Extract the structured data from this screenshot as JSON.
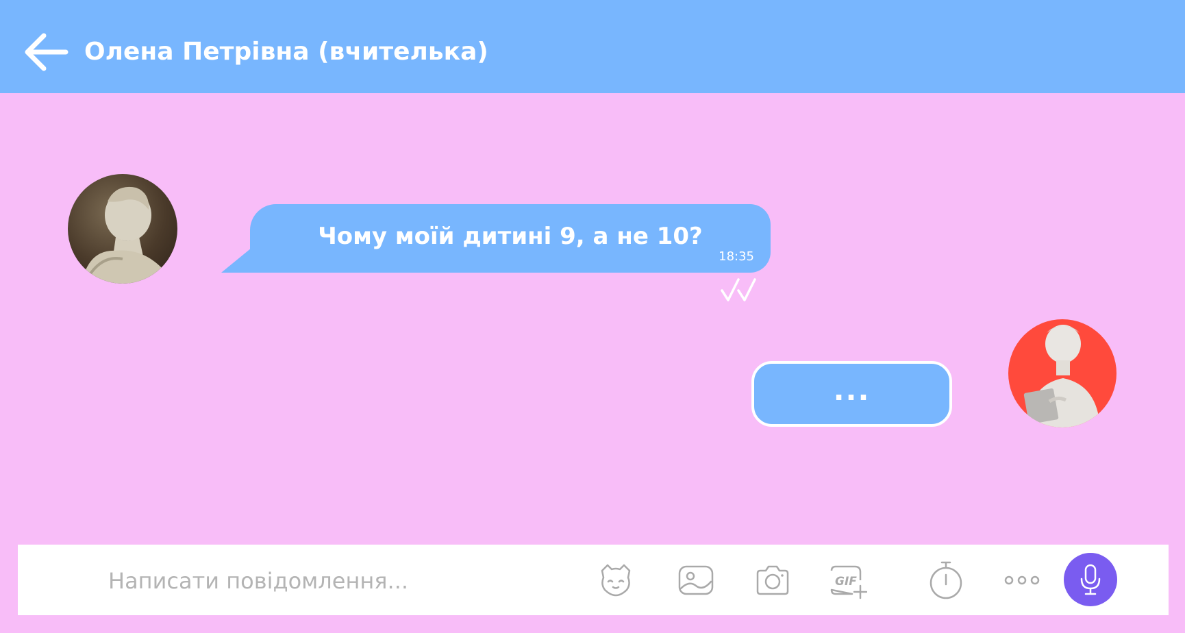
{
  "header": {
    "title": "Олена Петрівна (вчителька)",
    "back_icon": "arrow-left-icon"
  },
  "messages": [
    {
      "direction": "incoming",
      "text": "Чому моїй дитині 9, а не 10?",
      "time": "18:35",
      "status": "read"
    }
  ],
  "typing": {
    "text": "..."
  },
  "composer": {
    "placeholder": "Написати повідомлення...",
    "value": "",
    "icons": [
      "sticker-icon",
      "gallery-icon",
      "camera-icon",
      "gif-icon",
      "timer-icon",
      "more-icon",
      "microphone-icon"
    ]
  },
  "colors": {
    "header_bg": "#78b6fe",
    "chat_bg": "#f8bdf8",
    "bubble_bg": "#78b6fe",
    "user_avatar_bg": "#ff4a3c",
    "mic_button_bg": "#7a5cf0",
    "icon_stroke": "#a9a9a9"
  }
}
